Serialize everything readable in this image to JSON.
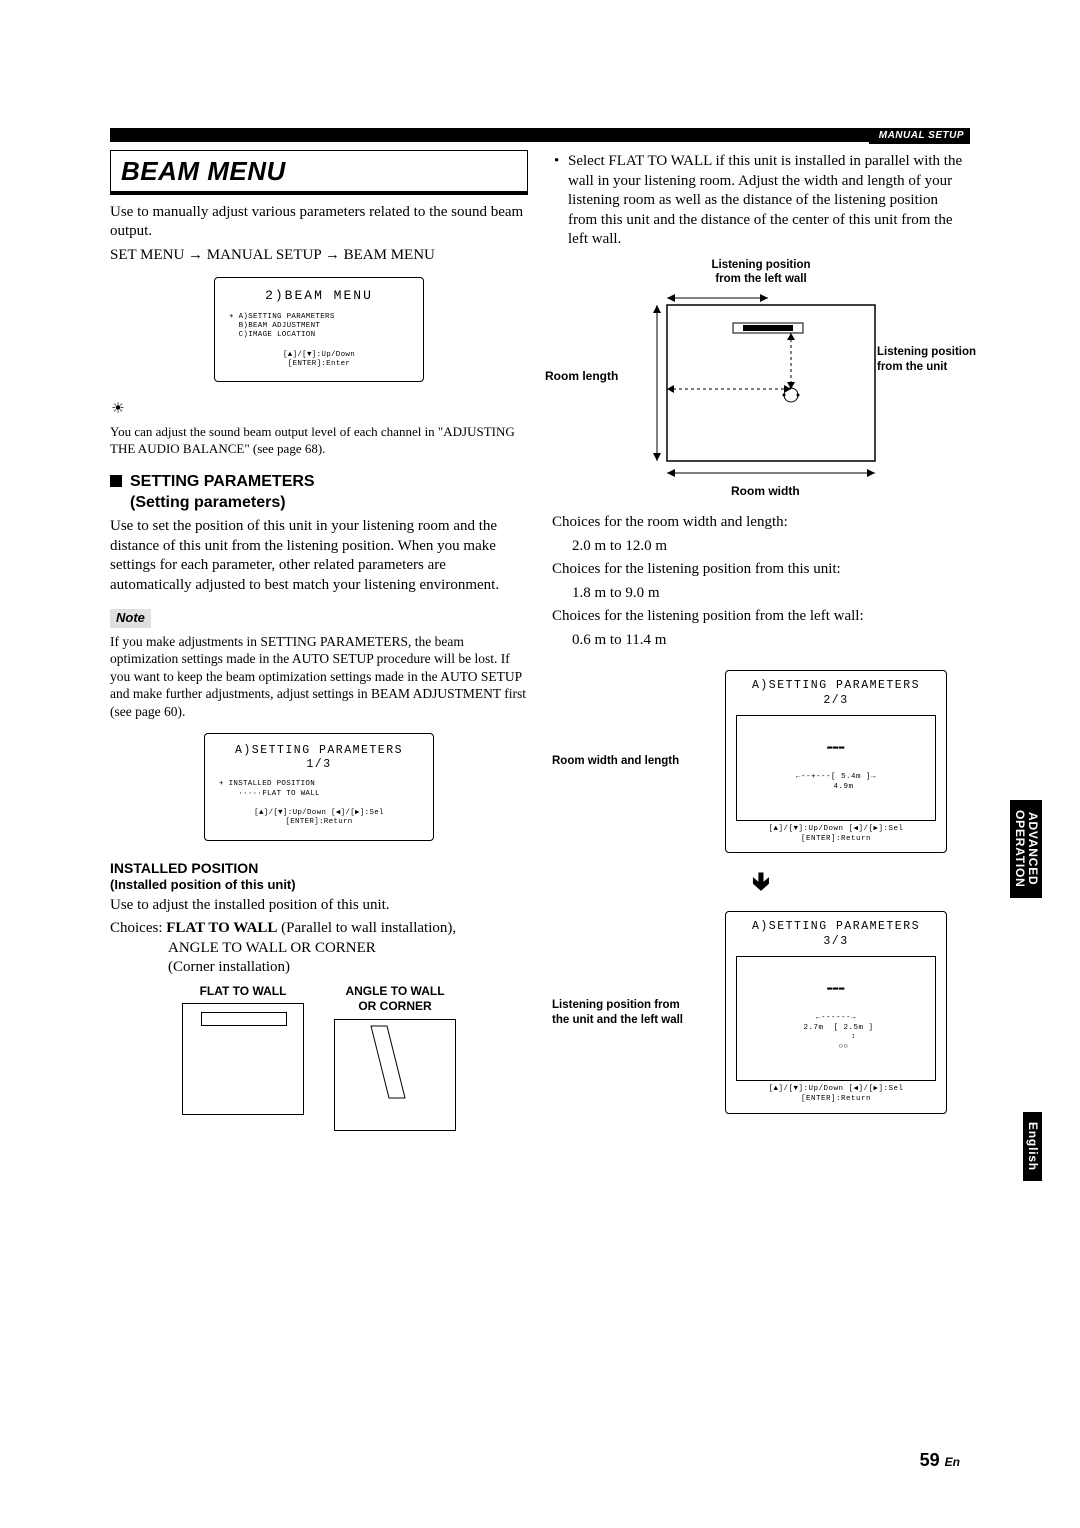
{
  "header": {
    "label": "MANUAL SETUP"
  },
  "left": {
    "section_title": "BEAM MENU",
    "intro1": "Use to manually adjust various parameters related to the sound beam output.",
    "nav": "SET MENU → MANUAL SETUP → BEAM MENU",
    "osd1": {
      "title": "2)BEAM MENU",
      "body": "+ A)SETTING PARAMETERS\n  B)BEAM ADJUSTMENT\n  C)IMAGE LOCATION",
      "foot": "[▲]/[▼]:Up/Down\n[ENTER]:Enter"
    },
    "tip": "You can adjust the sound beam output level of each channel in \"ADJUSTING THE AUDIO BALANCE\" (see page 68).",
    "sub1_title_line1": "SETTING PARAMETERS",
    "sub1_title_line2": "(Setting parameters)",
    "sub1_body": "Use to set the position of this unit in your listening room and the distance of this unit from the listening position. When you make settings for each parameter, other related parameters are automatically adjusted to best match your listening environment.",
    "note_label": "Note",
    "note_body": "If you make adjustments in SETTING PARAMETERS, the beam optimization settings made in the AUTO SETUP procedure will be lost. If you want to keep the beam optimization settings made in the AUTO SETUP and make further adjustments, adjust settings in BEAM ADJUSTMENT first (see page 60).",
    "osd2": {
      "title": "A)SETTING PARAMETERS 1/3",
      "body": "+ INSTALLED POSITION\n    ·····FLAT TO WALL",
      "foot": "[▲]/[▼]:Up/Down [◀]/[▶]:Sel\n[ENTER]:Return"
    },
    "installed_heading": "INSTALLED POSITION",
    "installed_sub": "(Installed position of this unit)",
    "installed_body1": "Use to adjust the installed position of this unit.",
    "choices_label": "Choices:",
    "choice1_bold": "FLAT TO WALL",
    "choice1_rest": " (Parallel to wall installation),",
    "choice2": "ANGLE TO WALL OR CORNER",
    "choice3": "(Corner installation)",
    "box1_label": "FLAT TO WALL",
    "box2_label_l1": "ANGLE TO WALL",
    "box2_label_l2": "OR CORNER"
  },
  "right": {
    "bullet1": "Select FLAT TO WALL if this unit is installed in parallel with the wall in your listening room. Adjust the width and length of your listening room as well as the distance of the listening position from this unit and the distance of the center of this unit from the left wall.",
    "diag": {
      "top_label_l1": "Listening position",
      "top_label_l2": "from the left wall",
      "right_label_l1": "Listening position",
      "right_label_l2": "from the unit",
      "left_label": "Room length",
      "bottom_label": "Room width"
    },
    "choices_room": "Choices for the room width and length:",
    "choices_room_val": "2.0 m to 12.0 m",
    "choices_lp_unit": "Choices for the listening position from this unit:",
    "choices_lp_unit_val": "1.8 m to 9.0 m",
    "choices_lp_wall": "Choices for the listening position from the left wall:",
    "choices_lp_wall_val": "0.6 m to 11.4 m",
    "osd3": {
      "title": "A)SETTING PARAMETERS 2/3",
      "inner": "←--+---[ 5.4m ]→\n   4.9m",
      "foot": "[▲]/[▼]:Up/Down [◀]/[▶]:Sel\n[ENTER]:Return",
      "side_label": "Room width and length"
    },
    "osd4": {
      "title": "A)SETTING PARAMETERS 3/3",
      "inner": "←------→\n 2.7m  [ 2.5m ]\n       ↕\n   ○○",
      "foot": "[▲]/[▼]:Up/Down [◀]/[▶]:Sel\n[ENTER]:Return",
      "side_label": "Listening position from the unit and the left wall"
    }
  },
  "side_tabs": {
    "advanced_l1": "ADVANCED",
    "advanced_l2": "OPERATION",
    "english": "English"
  },
  "page_number": {
    "num": "59",
    "lang": "En"
  }
}
